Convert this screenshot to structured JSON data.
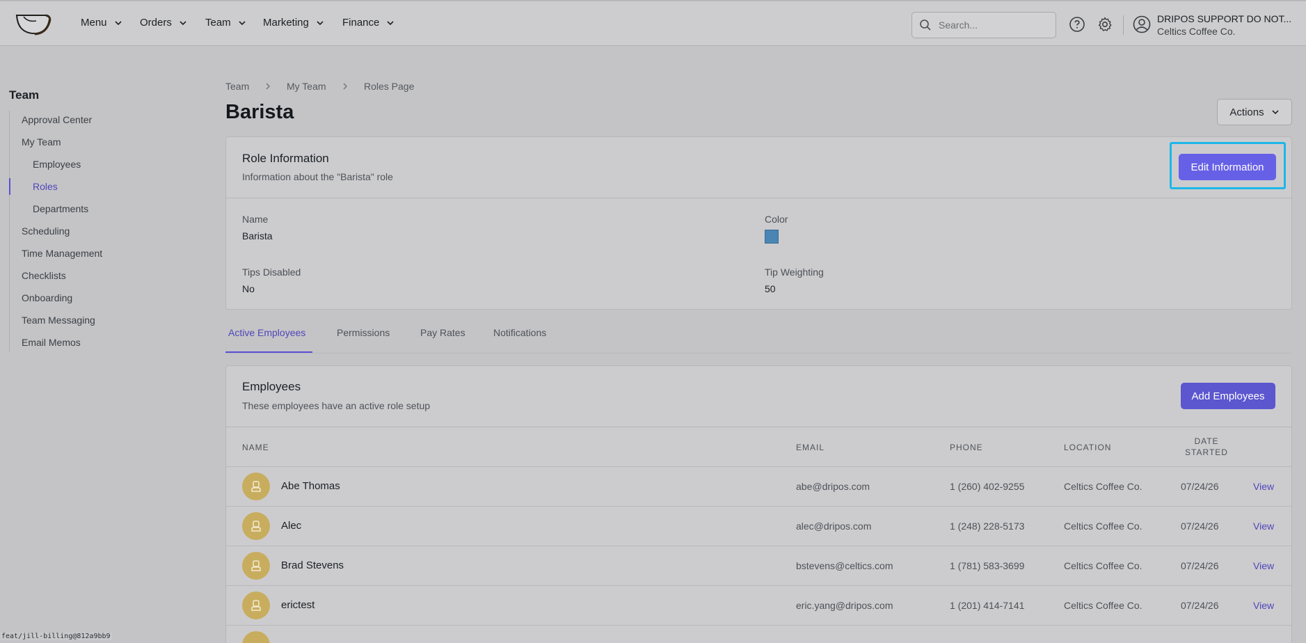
{
  "nav": {
    "items": [
      "Menu",
      "Orders",
      "Team",
      "Marketing",
      "Finance"
    ],
    "search_placeholder": "Search...",
    "user_name": "DRIPOS SUPPORT DO NOT...",
    "user_org": "Celtics Coffee Co."
  },
  "sidebar": {
    "title": "Team",
    "items": [
      {
        "label": "Approval Center"
      },
      {
        "label": "My Team"
      },
      {
        "label": "Employees"
      },
      {
        "label": "Roles"
      },
      {
        "label": "Departments"
      },
      {
        "label": "Scheduling"
      },
      {
        "label": "Time Management"
      },
      {
        "label": "Checklists"
      },
      {
        "label": "Onboarding"
      },
      {
        "label": "Team Messaging"
      },
      {
        "label": "Email Memos"
      }
    ],
    "active": "Roles"
  },
  "breadcrumb": [
    "Team",
    "My Team",
    "Roles Page"
  ],
  "page": {
    "title": "Barista",
    "actions_label": "Actions"
  },
  "role_card": {
    "title": "Role Information",
    "subtitle": "Information about the \"Barista\" role",
    "edit_label": "Edit Information",
    "fields": {
      "name_label": "Name",
      "name_value": "Barista",
      "color_label": "Color",
      "color_value": "#4a86b4",
      "tips_label": "Tips Disabled",
      "tips_value": "No",
      "weight_label": "Tip Weighting",
      "weight_value": "50"
    }
  },
  "tabs": [
    "Active Employees",
    "Permissions",
    "Pay Rates",
    "Notifications"
  ],
  "employees_card": {
    "title": "Employees",
    "subtitle": "These employees have an active role setup",
    "add_label": "Add Employees",
    "columns": [
      "NAME",
      "EMAIL",
      "PHONE",
      "LOCATION",
      "DATE",
      "STARTED"
    ],
    "rows": [
      {
        "name": "Abe Thomas",
        "email": "abe@dripos.com",
        "phone": "1 (260) 402-9255",
        "location": "Celtics Coffee Co.",
        "date": "07/24/26",
        "action": "View"
      },
      {
        "name": "Alec",
        "email": "alec@dripos.com",
        "phone": "1 (248) 228-5173",
        "location": "Celtics Coffee Co.",
        "date": "07/24/26",
        "action": "View"
      },
      {
        "name": "Brad Stevens",
        "email": "bstevens@celtics.com",
        "phone": "1 (781) 583-3699",
        "location": "Celtics Coffee Co.",
        "date": "07/24/26",
        "action": "View"
      },
      {
        "name": "erictest",
        "email": "eric.yang@dripos.com",
        "phone": "1 (201) 414-7141",
        "location": "Celtics Coffee Co.",
        "date": "07/24/26",
        "action": "View"
      }
    ]
  },
  "footer_note": "feat/jill-billing@812a9bb9"
}
